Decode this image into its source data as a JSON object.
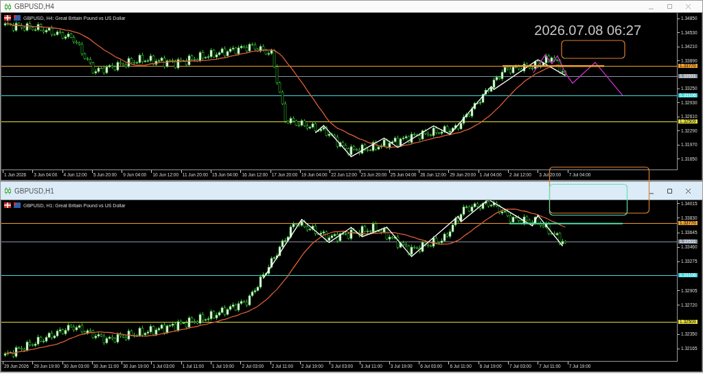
{
  "windows": [
    {
      "title": "GBPUSD,H4",
      "active": false,
      "symbol_info": "GBPUSD, H4:  Great Britain Pound vs US Dollar",
      "clock": "2026.07.08 06:27",
      "price_ticks": [
        "1.34850",
        "1.34530",
        "1.34210",
        "1.33890",
        "1.33250",
        "1.32930",
        "1.32610",
        "1.32290",
        "1.31970",
        "1.31650"
      ],
      "levels": [
        {
          "price": "1.33770",
          "color": "#f0a030"
        },
        {
          "price": "1.33531",
          "color": "#8a94a0"
        },
        {
          "price": "1.33106",
          "color": "#40d8e0"
        },
        {
          "price": "1.32509",
          "color": "#e8e040"
        }
      ],
      "time_labels": [
        "1 Jun 2026",
        "3 Jun 04:00",
        "4 Jun 12:00",
        "5 Jun 20:00",
        "9 Jun 04:00",
        "10 Jun 12:00",
        "11 Jun 20:00",
        "15 Jun 04:00",
        "16 Jun 12:00",
        "17 Jun 20:00",
        "19 Jun 04:00",
        "22 Jun 12:00",
        "23 Jun 20:00",
        "25 Jun 04:00",
        "26 Jun 12:00",
        "29 Jun 20:00",
        "1 Jul 04:00",
        "2 Jul 12:00",
        "3 Jul 20:00",
        "7 Jul 04:00"
      ]
    },
    {
      "title": "GBPUSD,H1",
      "active": true,
      "symbol_info": "GBPUSD, H1:  Great Britain Pound vs US Dollar",
      "price_ticks": [
        "1.34015",
        "1.33830",
        "1.33645",
        "1.33460",
        "1.33275",
        "1.32905",
        "1.32720",
        "1.32350",
        "1.32165"
      ],
      "levels": [
        {
          "price": "1.33770",
          "color": "#f0a030"
        },
        {
          "price": "1.33531",
          "color": "#8a94a0"
        },
        {
          "price": "1.33106",
          "color": "#40d8e0"
        },
        {
          "price": "1.32509",
          "color": "#e8e040"
        }
      ],
      "time_labels": [
        "29 Jun 2026",
        "29 Jun 19:00",
        "30 Jun 03:00",
        "30 Jun 11:00",
        "30 Jun 19:00",
        "1 Jul 03:00",
        "1 Jul 11:00",
        "1 Jul 19:00",
        "2 Jul 03:00",
        "2 Jul 11:00",
        "2 Jul 19:00",
        "3 Jul 03:00",
        "3 Jul 11:00",
        "3 Jul 19:00",
        "6 Jul 03:00",
        "6 Jul 11:00",
        "6 Jul 19:00",
        "7 Jul 03:00",
        "7 Jul 11:00",
        "7 Jul 19:00"
      ]
    }
  ]
}
